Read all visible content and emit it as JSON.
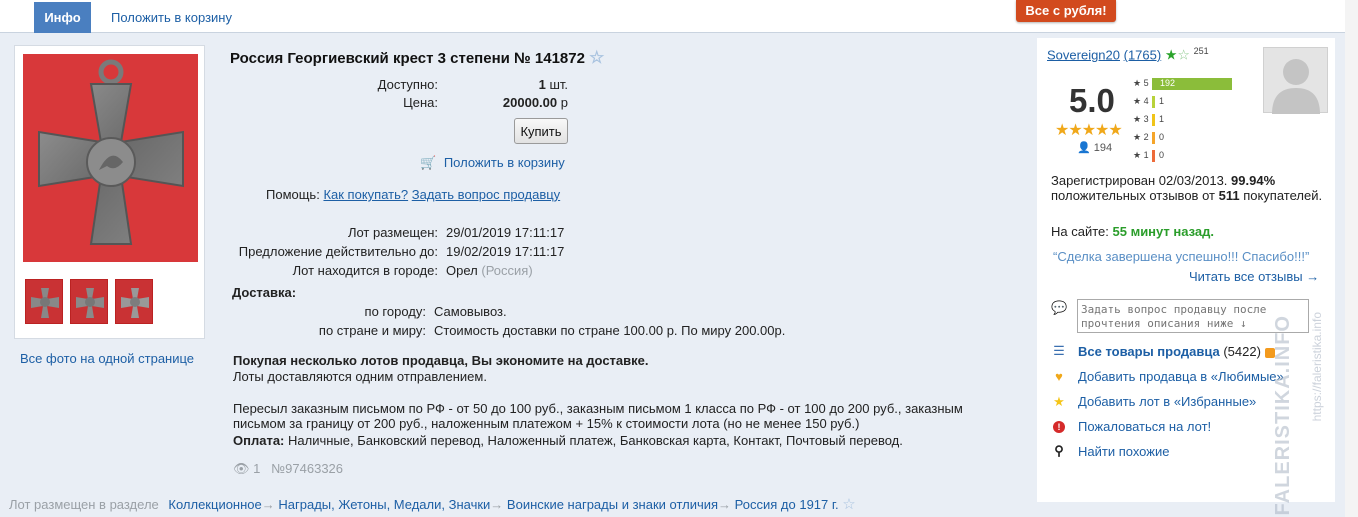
{
  "tabs": {
    "info": "Инфо",
    "cart": "Положить в корзину"
  },
  "promo": "Все с рубля!",
  "photos": {
    "all_link": "Все фото на одной странице"
  },
  "lot": {
    "title": "Россия Георгиевский крест 3 степени № 141872",
    "available_label": "Доступно:",
    "available_value": "1",
    "available_unit": "шт.",
    "price_label": "Цена:",
    "price_value": "20000.00",
    "price_unit": "р",
    "buy_button": "Купить",
    "add_to_cart": "Положить в корзину",
    "help_label": "Помощь:",
    "help_how": "Как покупать?",
    "help_ask": "Задать вопрос продавцу",
    "placed_label": "Лот размещен:",
    "placed_value": "29/01/2019 17:11:17",
    "valid_label": "Предложение действительно до:",
    "valid_value": "19/02/2019 17:11:17",
    "city_label": "Лот находится в городе:",
    "city_value": "Орел",
    "country_value": "(Россия)",
    "delivery_title": "Доставка:",
    "delivery_city_label": "по городу:",
    "delivery_city_value": "Самовывоз.",
    "delivery_world_label": "по стране и миру:",
    "delivery_world_value": "Стоимость доставки по стране 100.00 р. По миру 200.00р.",
    "savings_title": "Покупая несколько лотов продавца, Вы экономите на доставке.",
    "savings_text": "Лоты доставляются одним отправлением.",
    "shipping_text_1": "Пересыл заказным письмом по РФ - от 50 до 100 руб., заказным письмом 1 класса по РФ - от 100 до 200 руб., заказным",
    "shipping_text_2": "письмом за границу от 200 руб., наложенным платежом + 15% к стоимости лота (но не менее 150 руб.)",
    "payment_label": "Оплата:",
    "payment_value": "Наличные, Банковский перевод, Наложенный платеж, Банковская карта, Контакт, Почтовый перевод.",
    "views": "1",
    "lot_number": "№97463326"
  },
  "breadcrumb": {
    "prefix": "Лот размещен в разделе",
    "items": [
      "Коллекционное",
      "Награды, Жетоны, Медали, Значки",
      "Воинские награды и знаки отличия",
      "Россия до 1917 г."
    ],
    "separator": "→"
  },
  "seller": {
    "name": "Sovereign20",
    "count": "(1765)",
    "star_count": "251",
    "rating": "5.0",
    "reviews_count": "194",
    "bars": [
      {
        "label": "5",
        "value": 192,
        "color": "#8bbd3a"
      },
      {
        "label": "4",
        "value": 1,
        "color": "#b8d23a"
      },
      {
        "label": "3",
        "value": 1,
        "color": "#f0c419"
      },
      {
        "label": "2",
        "value": 0,
        "color": "#f5a52a"
      },
      {
        "label": "1",
        "value": 0,
        "color": "#ee6b3a"
      }
    ],
    "registered": "Зарегистрирован 02/03/2013.",
    "positive_pct": "99.94%",
    "positive_text": "положительных отзывов от",
    "buyers_count": "511",
    "buyers_label": "покупателей.",
    "online_label": "На сайте:",
    "online_value": "55 минут назад.",
    "review_quote": "Сделка завершена успешно!!! Спасибо!!!",
    "read_all": "Читать все отзывы",
    "question_placeholder": "Задать вопрос продавцу после прочтения описания ниже ↓",
    "all_goods": "Все товары продавца",
    "all_goods_count": "(5422)",
    "add_fav_seller": "Добавить продавца в «Любимые»",
    "add_fav_lot": "Добавить лот в «Избранные»",
    "complain": "Пожаловаться на лот!",
    "find_similar": "Найти похожие"
  },
  "watermark": "FALERISTIKA.INFO",
  "watermark_url": "https://faleristika.info",
  "colors": {
    "accent": "#1d5fa5",
    "tab": "#4a7fc0",
    "promo": "#d24a1e",
    "online": "#2a9d2a"
  }
}
